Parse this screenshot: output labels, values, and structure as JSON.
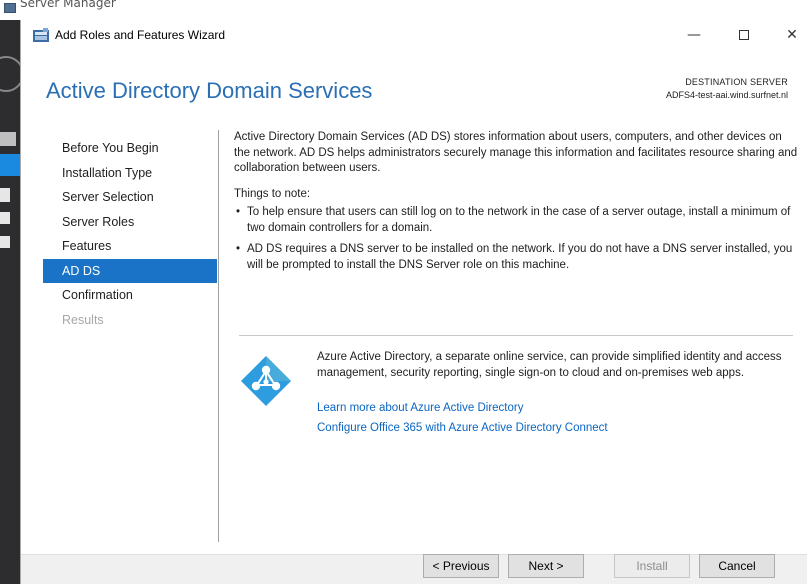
{
  "background_window": {
    "title": "Server Manager"
  },
  "dialog": {
    "title": "Add Roles and Features Wizard",
    "minimize": "—",
    "close": "✕"
  },
  "header": {
    "title": "Active Directory Domain Services",
    "destination_label": "DESTINATION SERVER",
    "destination_value": "ADFS4-test-aai.wind.surfnet.nl"
  },
  "nav": {
    "items": [
      {
        "label": "Before You Begin",
        "state": "normal"
      },
      {
        "label": "Installation Type",
        "state": "normal"
      },
      {
        "label": "Server Selection",
        "state": "normal"
      },
      {
        "label": "Server Roles",
        "state": "normal"
      },
      {
        "label": "Features",
        "state": "normal"
      },
      {
        "label": "AD DS",
        "state": "active"
      },
      {
        "label": "Confirmation",
        "state": "normal"
      },
      {
        "label": "Results",
        "state": "disabled"
      }
    ]
  },
  "content": {
    "intro": "Active Directory Domain Services (AD DS) stores information about users, computers, and other devices on the network.  AD DS helps administrators securely manage this information and facilitates resource sharing and collaboration between users.",
    "things_label": "Things to note:",
    "bullets": [
      "To help ensure that users can still log on to the network in the case of a server outage, install a minimum of two domain controllers for a domain.",
      "AD DS requires a DNS server to be installed on the network.  If you do not have a DNS server installed, you will be prompted to install the DNS Server role on this machine."
    ],
    "azure_text": "Azure Active Directory, a separate online service, can provide simplified identity and access management, security reporting, single sign-on to cloud and on-premises web apps.",
    "link_learn_more": "Learn more about Azure Active Directory",
    "link_configure": "Configure Office 365 with Azure Active Directory Connect"
  },
  "footer": {
    "previous": "< Previous",
    "next": "Next >",
    "install": "Install",
    "cancel": "Cancel"
  },
  "colors": {
    "accent": "#1a73c6",
    "header_blue": "#2a6fb5",
    "link": "#0a66c2",
    "azure_logo": "#2d9de0"
  }
}
